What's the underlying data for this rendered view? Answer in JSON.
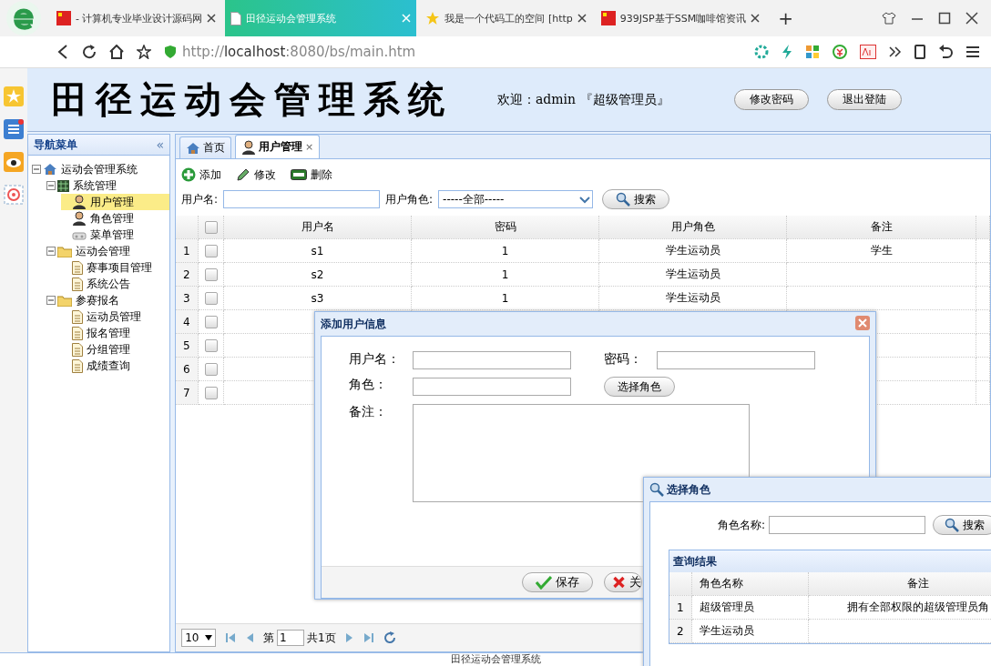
{
  "browser": {
    "tabs": [
      {
        "title": "- 计算机专业毕业设计源码网",
        "kind": "flag",
        "selected": false
      },
      {
        "title": "田径运动会管理系统",
        "kind": "page",
        "selected": true
      },
      {
        "title": "我是一个代码工的空间 [http",
        "kind": "star",
        "selected": false
      },
      {
        "title": "939JSP基于SSM咖啡馆资讯",
        "kind": "flag",
        "selected": false
      }
    ],
    "new_tab": "+",
    "url": {
      "scheme": "http://",
      "host": "localhost",
      "path": ":8080/bs/main.htm"
    }
  },
  "header": {
    "title": "田径运动会管理系统",
    "welcome": "欢迎：admin 『超级管理员』",
    "buttons": [
      "修改密码",
      "退出登陆"
    ]
  },
  "nav": {
    "title": "导航菜单",
    "collapse": "«",
    "tree": [
      {
        "label": "运动会管理系统",
        "kind": "home",
        "selected": false,
        "expanded": true,
        "children": [
          {
            "label": "系统管理",
            "kind": "grid",
            "selected": false,
            "expanded": true,
            "children": [
              {
                "label": "用户管理",
                "kind": "user",
                "selected": true
              },
              {
                "label": "角色管理",
                "kind": "user",
                "selected": false
              },
              {
                "label": "菜单管理",
                "kind": "menu",
                "selected": false
              }
            ]
          },
          {
            "label": "运动会管理",
            "kind": "folder",
            "selected": false,
            "expanded": true,
            "children": [
              {
                "label": "赛事项目管理",
                "kind": "page",
                "selected": false
              },
              {
                "label": "系统公告",
                "kind": "page",
                "selected": false
              }
            ]
          },
          {
            "label": "参赛报名",
            "kind": "folder",
            "selected": false,
            "expanded": true,
            "children": [
              {
                "label": "运动员管理",
                "kind": "page",
                "selected": false
              },
              {
                "label": "报名管理",
                "kind": "page",
                "selected": false
              },
              {
                "label": "分组管理",
                "kind": "page",
                "selected": false
              },
              {
                "label": "成绩查询",
                "kind": "page",
                "selected": false
              }
            ]
          }
        ]
      }
    ]
  },
  "tabs": [
    {
      "label": "首页",
      "kind": "home",
      "selected": false
    },
    {
      "label": "用户管理",
      "kind": "user",
      "selected": true,
      "close": "×"
    }
  ],
  "toolbar": [
    {
      "label": "添加",
      "kind": "add"
    },
    {
      "label": "修改",
      "kind": "edit"
    },
    {
      "label": "删除",
      "kind": "delete"
    }
  ],
  "filters": {
    "username_label": "用户名:",
    "role_label": "用户角色:",
    "role_value": "-----全部-----",
    "search": "搜索"
  },
  "table": {
    "all_checked": false,
    "columns": [
      "用户名",
      "密码",
      "用户角色",
      "备注"
    ],
    "rows": [
      {
        "number": "1",
        "checked": false,
        "cells": [
          "s1",
          "1",
          "学生运动员",
          "学生"
        ]
      },
      {
        "number": "2",
        "checked": false,
        "cells": [
          "s2",
          "1",
          "学生运动员"
        ]
      },
      {
        "number": "3",
        "checked": false,
        "cells": [
          "s3",
          "1",
          "学生运动员"
        ]
      },
      {
        "number": "4",
        "checked": false
      },
      {
        "number": "5",
        "checked": false
      },
      {
        "number": "6",
        "checked": false
      },
      {
        "number": "7",
        "checked": false
      }
    ]
  },
  "pager": {
    "page_size": "10",
    "page_label": "第",
    "page": "1",
    "total": "共1页"
  },
  "add_dialog": {
    "title": "添加用户信息",
    "fields": [
      {
        "label": "用户名：",
        "kind": "input"
      },
      {
        "label": "密码：",
        "kind": "input"
      },
      {
        "label": "角色：",
        "kind": "input"
      },
      {
        "label": "备注：",
        "kind": "textarea"
      }
    ],
    "choose_role": "选择角色",
    "buttons": [
      {
        "label": "保存",
        "kind": "save"
      },
      {
        "label": "关",
        "kind": "close"
      }
    ]
  },
  "role_dialog": {
    "title": "选择角色",
    "name_label": "角色名称:",
    "search": "搜索",
    "results_title": "查询结果",
    "columns": [
      "角色名称",
      "备注"
    ],
    "rows": [
      {
        "number": "1",
        "cells": [
          "超级管理员",
          "拥有全部权限的超级管理员角"
        ]
      },
      {
        "number": "2",
        "cells": [
          "学生运动员"
        ]
      }
    ]
  },
  "footer": "田径运动会管理系统"
}
